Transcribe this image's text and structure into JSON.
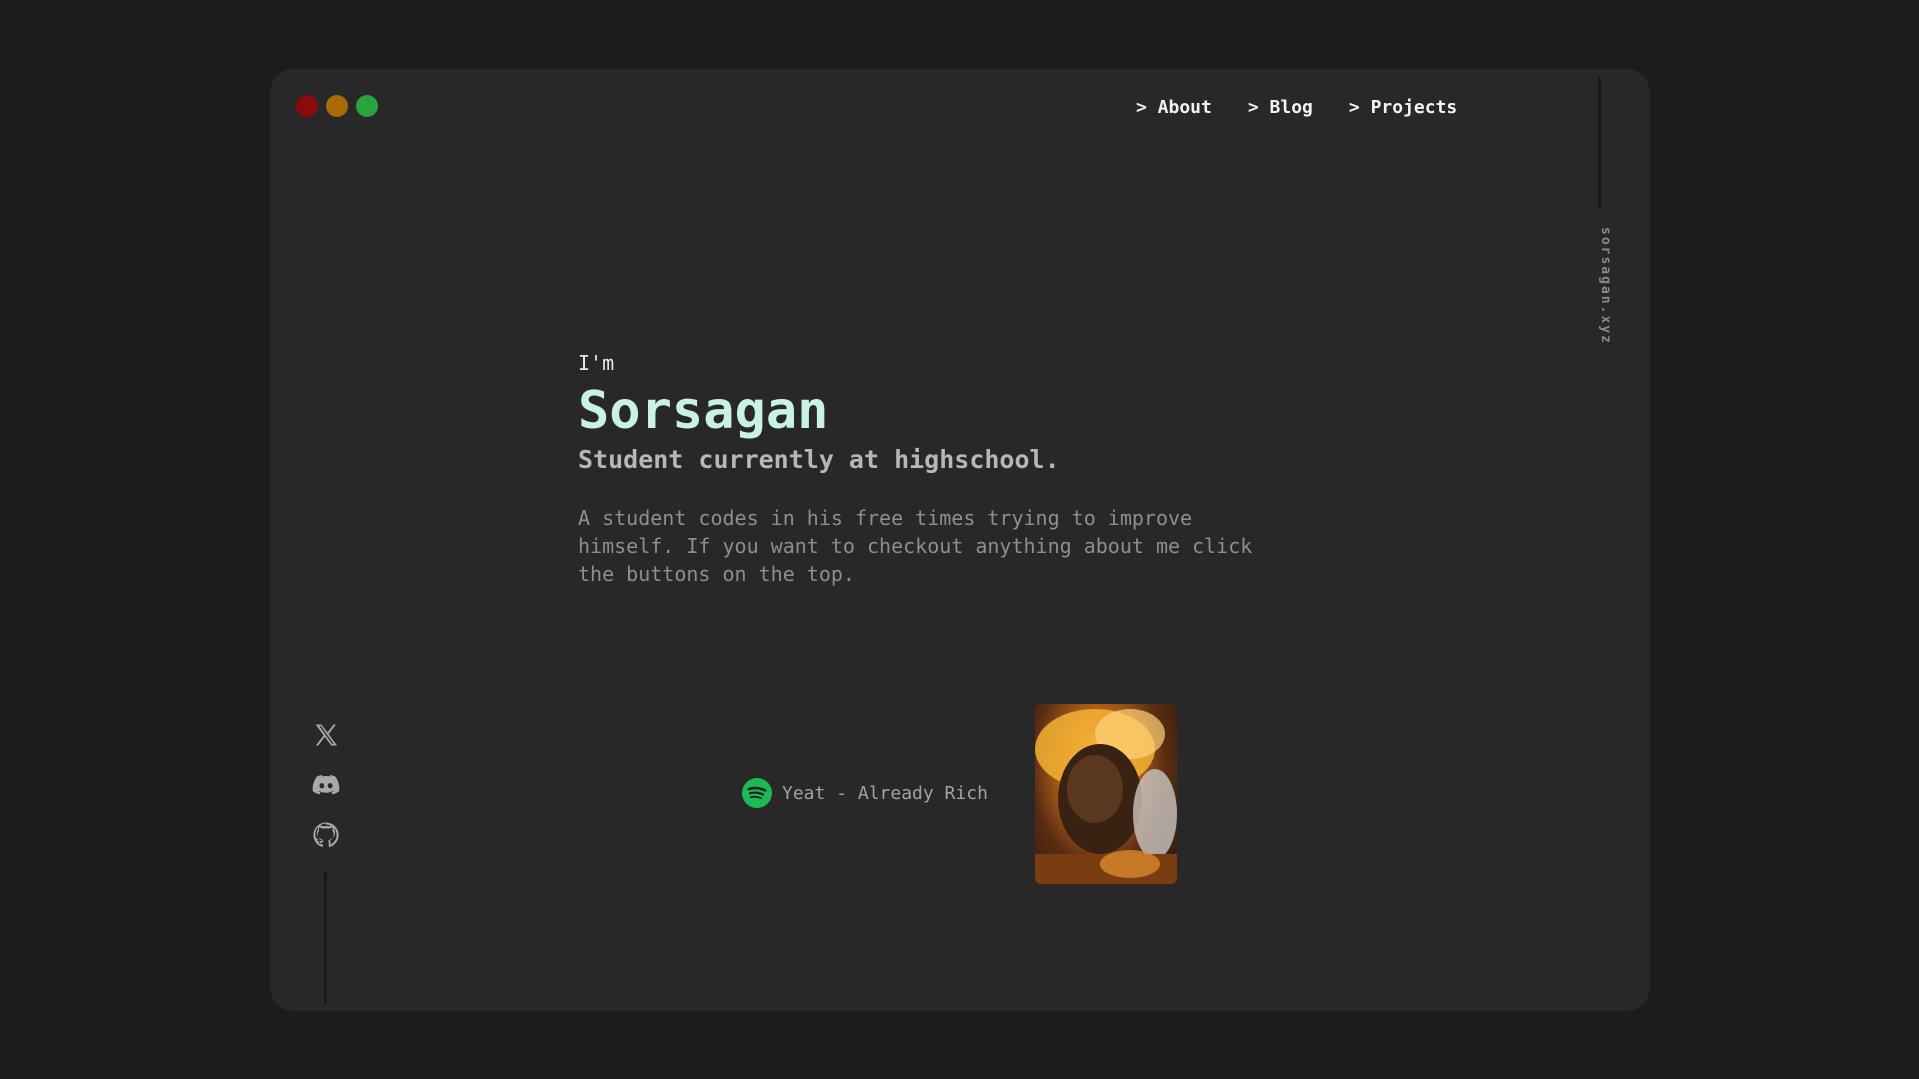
{
  "window": {
    "traffic_lights": {
      "close": "#8b0b0b",
      "minimize": "#a86b0a",
      "maximize": "#27a43d"
    }
  },
  "nav": {
    "items": [
      {
        "label": "> About"
      },
      {
        "label": "> Blog"
      },
      {
        "label": "> Projects"
      }
    ]
  },
  "site_name": "sorsagan.xyz",
  "hero": {
    "intro": "I'm",
    "name": "Sorsagan",
    "subtitle": "Student currently at highschool.",
    "description": "A student codes in his free times trying to improve himself. If you want to checkout anything about me click the buttons on the top."
  },
  "social": [
    {
      "icon": "x-icon"
    },
    {
      "icon": "discord-icon"
    },
    {
      "icon": "github-icon"
    }
  ],
  "now_playing": {
    "icon": "spotify-icon",
    "track": "Yeat - Already Rich",
    "accent": "#1db954"
  },
  "colors": {
    "background": "#1c1c1c",
    "window": "#282828",
    "name_accent": "#c9f1e6"
  }
}
